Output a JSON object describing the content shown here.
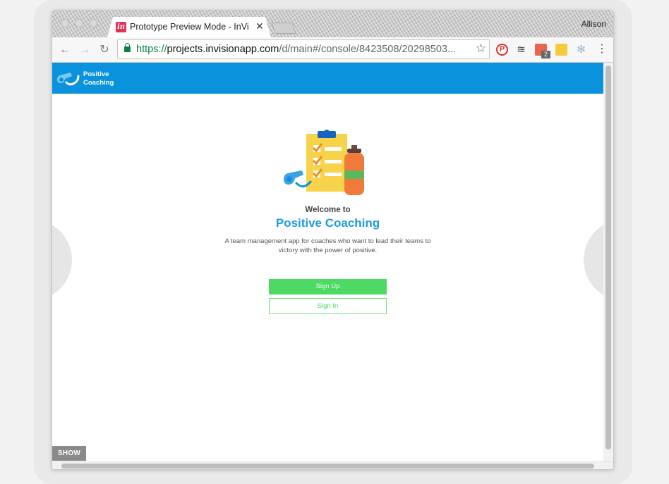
{
  "browser": {
    "tab_title": "Prototype Preview Mode - InVi",
    "favicon_text": "in",
    "profile_name": "Allison",
    "url": {
      "protocol": "https://",
      "host": "projects.invisionapp.com",
      "path": "/d/main#/console/8423508/20298503..."
    },
    "extensions": [
      "pinterest-icon",
      "buffer-icon",
      "calendar-icon",
      "note-icon",
      "snowflake-icon"
    ],
    "calendar_badge": "2"
  },
  "app": {
    "brand_line1": "Positive",
    "brand_line2": "Coaching",
    "welcome": "Welcome to",
    "title": "Positive Coaching",
    "tagline": "A team management app for coaches who want to lead their teams to victory with the power of positive.",
    "signup_label": "Sign Up",
    "signin_label": "Sign In"
  },
  "prototype": {
    "show_label": "SHOW"
  },
  "colors": {
    "app_bar": "#0a93dc",
    "brand_title": "#1b9be0",
    "signup_button": "#4cd964",
    "favicon": "#e5315b",
    "secure_url": "#0b8043"
  }
}
